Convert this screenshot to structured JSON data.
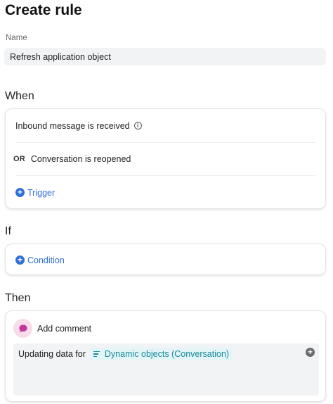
{
  "header": {
    "title": "Create rule"
  },
  "name_field": {
    "label": "Name",
    "value": "Refresh application object"
  },
  "when": {
    "title": "When",
    "triggers": [
      {
        "label": "Inbound message is received",
        "has_info": true
      },
      {
        "prefix": "OR",
        "label": "Conversation is reopened"
      }
    ],
    "add_label": "Trigger"
  },
  "if": {
    "title": "If",
    "add_label": "Condition"
  },
  "then": {
    "title": "Then",
    "action": {
      "icon": "comment-icon",
      "label": "Add comment",
      "text": "Updating data for",
      "chip_label": "Dynamic objects (Conversation)"
    }
  },
  "icons": {
    "plus": "+",
    "info": "i"
  },
  "colors": {
    "accent": "#2f6fd6",
    "chip_text": "#1a8a9a",
    "chip_bg": "#e3f5f7",
    "comment_bg": "#f7dcea",
    "comment_icon": "#c2369b"
  }
}
